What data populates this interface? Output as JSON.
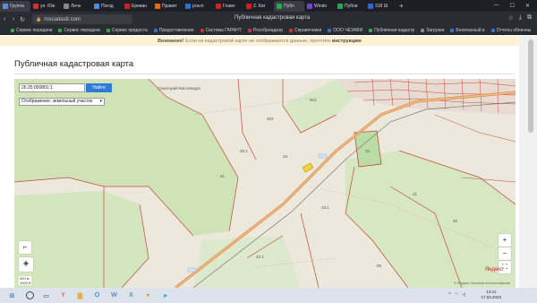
{
  "browser": {
    "tabs": [
      {
        "label": "Группа",
        "color": "#5b8dd8",
        "active": true
      },
      {
        "label": "ул. Юж",
        "color": "#cc3333",
        "active": false
      },
      {
        "label": "Личн",
        "color": "#888888",
        "active": false
      },
      {
        "label": "Погод",
        "color": "#4a90e2",
        "active": false
      },
      {
        "label": "Ереван",
        "color": "#cc2222",
        "active": false
      },
      {
        "label": "Правит",
        "color": "#ee6600",
        "active": false
      },
      {
        "label": "pravo",
        "color": "#2277cc",
        "active": false
      },
      {
        "label": "Главн",
        "color": "#cc2222",
        "active": false
      },
      {
        "label": "Z. Кат",
        "color": "#cc2222",
        "active": false
      },
      {
        "label": "Публ",
        "color": "#22aa55",
        "active": true
      },
      {
        "label": "Windo",
        "color": "#7744cc",
        "active": false
      },
      {
        "label": "Публи",
        "color": "#22aa55",
        "active": false
      },
      {
        "label": "318 Ш",
        "color": "#3366cc",
        "active": false
      }
    ],
    "new_tab": "+",
    "window_controls": [
      "—",
      "☐",
      "✕"
    ],
    "address": "roscadastr.com",
    "page_title": "Публичная кадастровая карта",
    "bookmarks": [
      {
        "label": "Сервис передачи",
        "color": "#3aa657"
      },
      {
        "label": "Сервис передачи",
        "color": "#3aa657"
      },
      {
        "label": "Сервис предоста",
        "color": "#3aa657"
      },
      {
        "label": "Предоставление",
        "color": "#3a6fd0"
      },
      {
        "label": "Система ГАРАНТ",
        "color": "#c83535"
      },
      {
        "label": "Рособрнадзор",
        "color": "#c83535"
      },
      {
        "label": "Справочники",
        "color": "#c83535"
      },
      {
        "label": "ООО ЧЕЗАВИ",
        "color": "#3a6fd0"
      },
      {
        "label": "Публичная кадастр",
        "color": "#3aa657"
      },
      {
        "label": "Загрузки",
        "color": "#888888"
      },
      {
        "label": "Безопасный в",
        "color": "#3a6fd0"
      },
      {
        "label": "Отчеты облачны",
        "color": "#3a6fd0"
      }
    ]
  },
  "page": {
    "warning_prefix": "Внимание!",
    "warning_text": "Если на кадастровой карте не отображаются данные, прочтите",
    "warning_link": "инструкцию",
    "title": "Публичная кадастровая карта"
  },
  "map": {
    "search_value": "26:25:000801:1",
    "find_button": "Найти",
    "layer_select": "Отображение: земельный участок",
    "zoom_in": "+",
    "zoom_out": "−",
    "fullscreen": "⛶",
    "layers_icon": "layers-icon",
    "scale_label": "300 м",
    "scale_sub": "1000 ft",
    "yandex_logo": "Яндекс",
    "copyright": "© Яндекс  Условия использования"
  },
  "taskbar": {
    "icons": [
      {
        "name": "windows-start-icon",
        "glyph": "⊞",
        "color": "#1b6ac9"
      },
      {
        "name": "search-icon",
        "glyph": "",
        "color": "#333"
      },
      {
        "name": "task-view-icon",
        "glyph": "▭",
        "color": "#333"
      },
      {
        "name": "yandex-browser-icon",
        "glyph": "Y",
        "color": "#e23a2e"
      },
      {
        "name": "file-explorer-icon",
        "glyph": "▇",
        "color": "#e2b33a"
      },
      {
        "name": "outlook-icon",
        "glyph": "O",
        "color": "#1b6ac9"
      },
      {
        "name": "word-icon",
        "glyph": "W",
        "color": "#2b5fb8"
      },
      {
        "name": "excel-icon",
        "glyph": "X",
        "color": "#1f7a44"
      },
      {
        "name": "chrome-icon",
        "glyph": "●",
        "color": "#d4a422"
      },
      {
        "name": "telegram-icon",
        "glyph": "➤",
        "color": "#2a9fd6"
      }
    ],
    "time": "14:41",
    "date": "17.04.2023"
  }
}
